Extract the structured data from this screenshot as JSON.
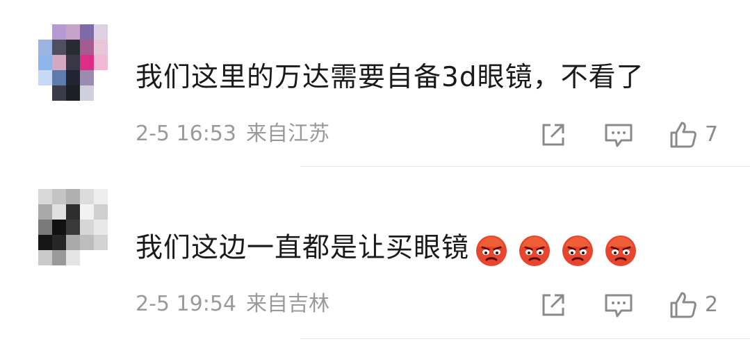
{
  "comments": [
    {
      "username": "",
      "text": "我们这里的万达需要自备3d眼镜，不看了",
      "date": "2-5 16:53",
      "location": "来自江苏",
      "likes": "7",
      "emojis": [],
      "icons": {
        "share": "share-icon",
        "reply": "comment-icon",
        "like": "thumbs-up-icon"
      }
    },
    {
      "username": "",
      "text": "我们这边一直都是让买眼镜",
      "date": "2-5 19:54",
      "location": "来自吉林",
      "likes": "2",
      "emojis": [
        "angry-emoji",
        "angry-emoji",
        "angry-emoji",
        "angry-emoji"
      ],
      "icons": {
        "share": "share-icon",
        "reply": "comment-icon",
        "like": "thumbs-up-icon"
      }
    }
  ],
  "colors": {
    "text": "#1a1a1a",
    "meta": "#9a9a9a",
    "icon": "#8a8a8a",
    "divider": "#e6e6e6",
    "emoji_face": "#e8452e"
  }
}
